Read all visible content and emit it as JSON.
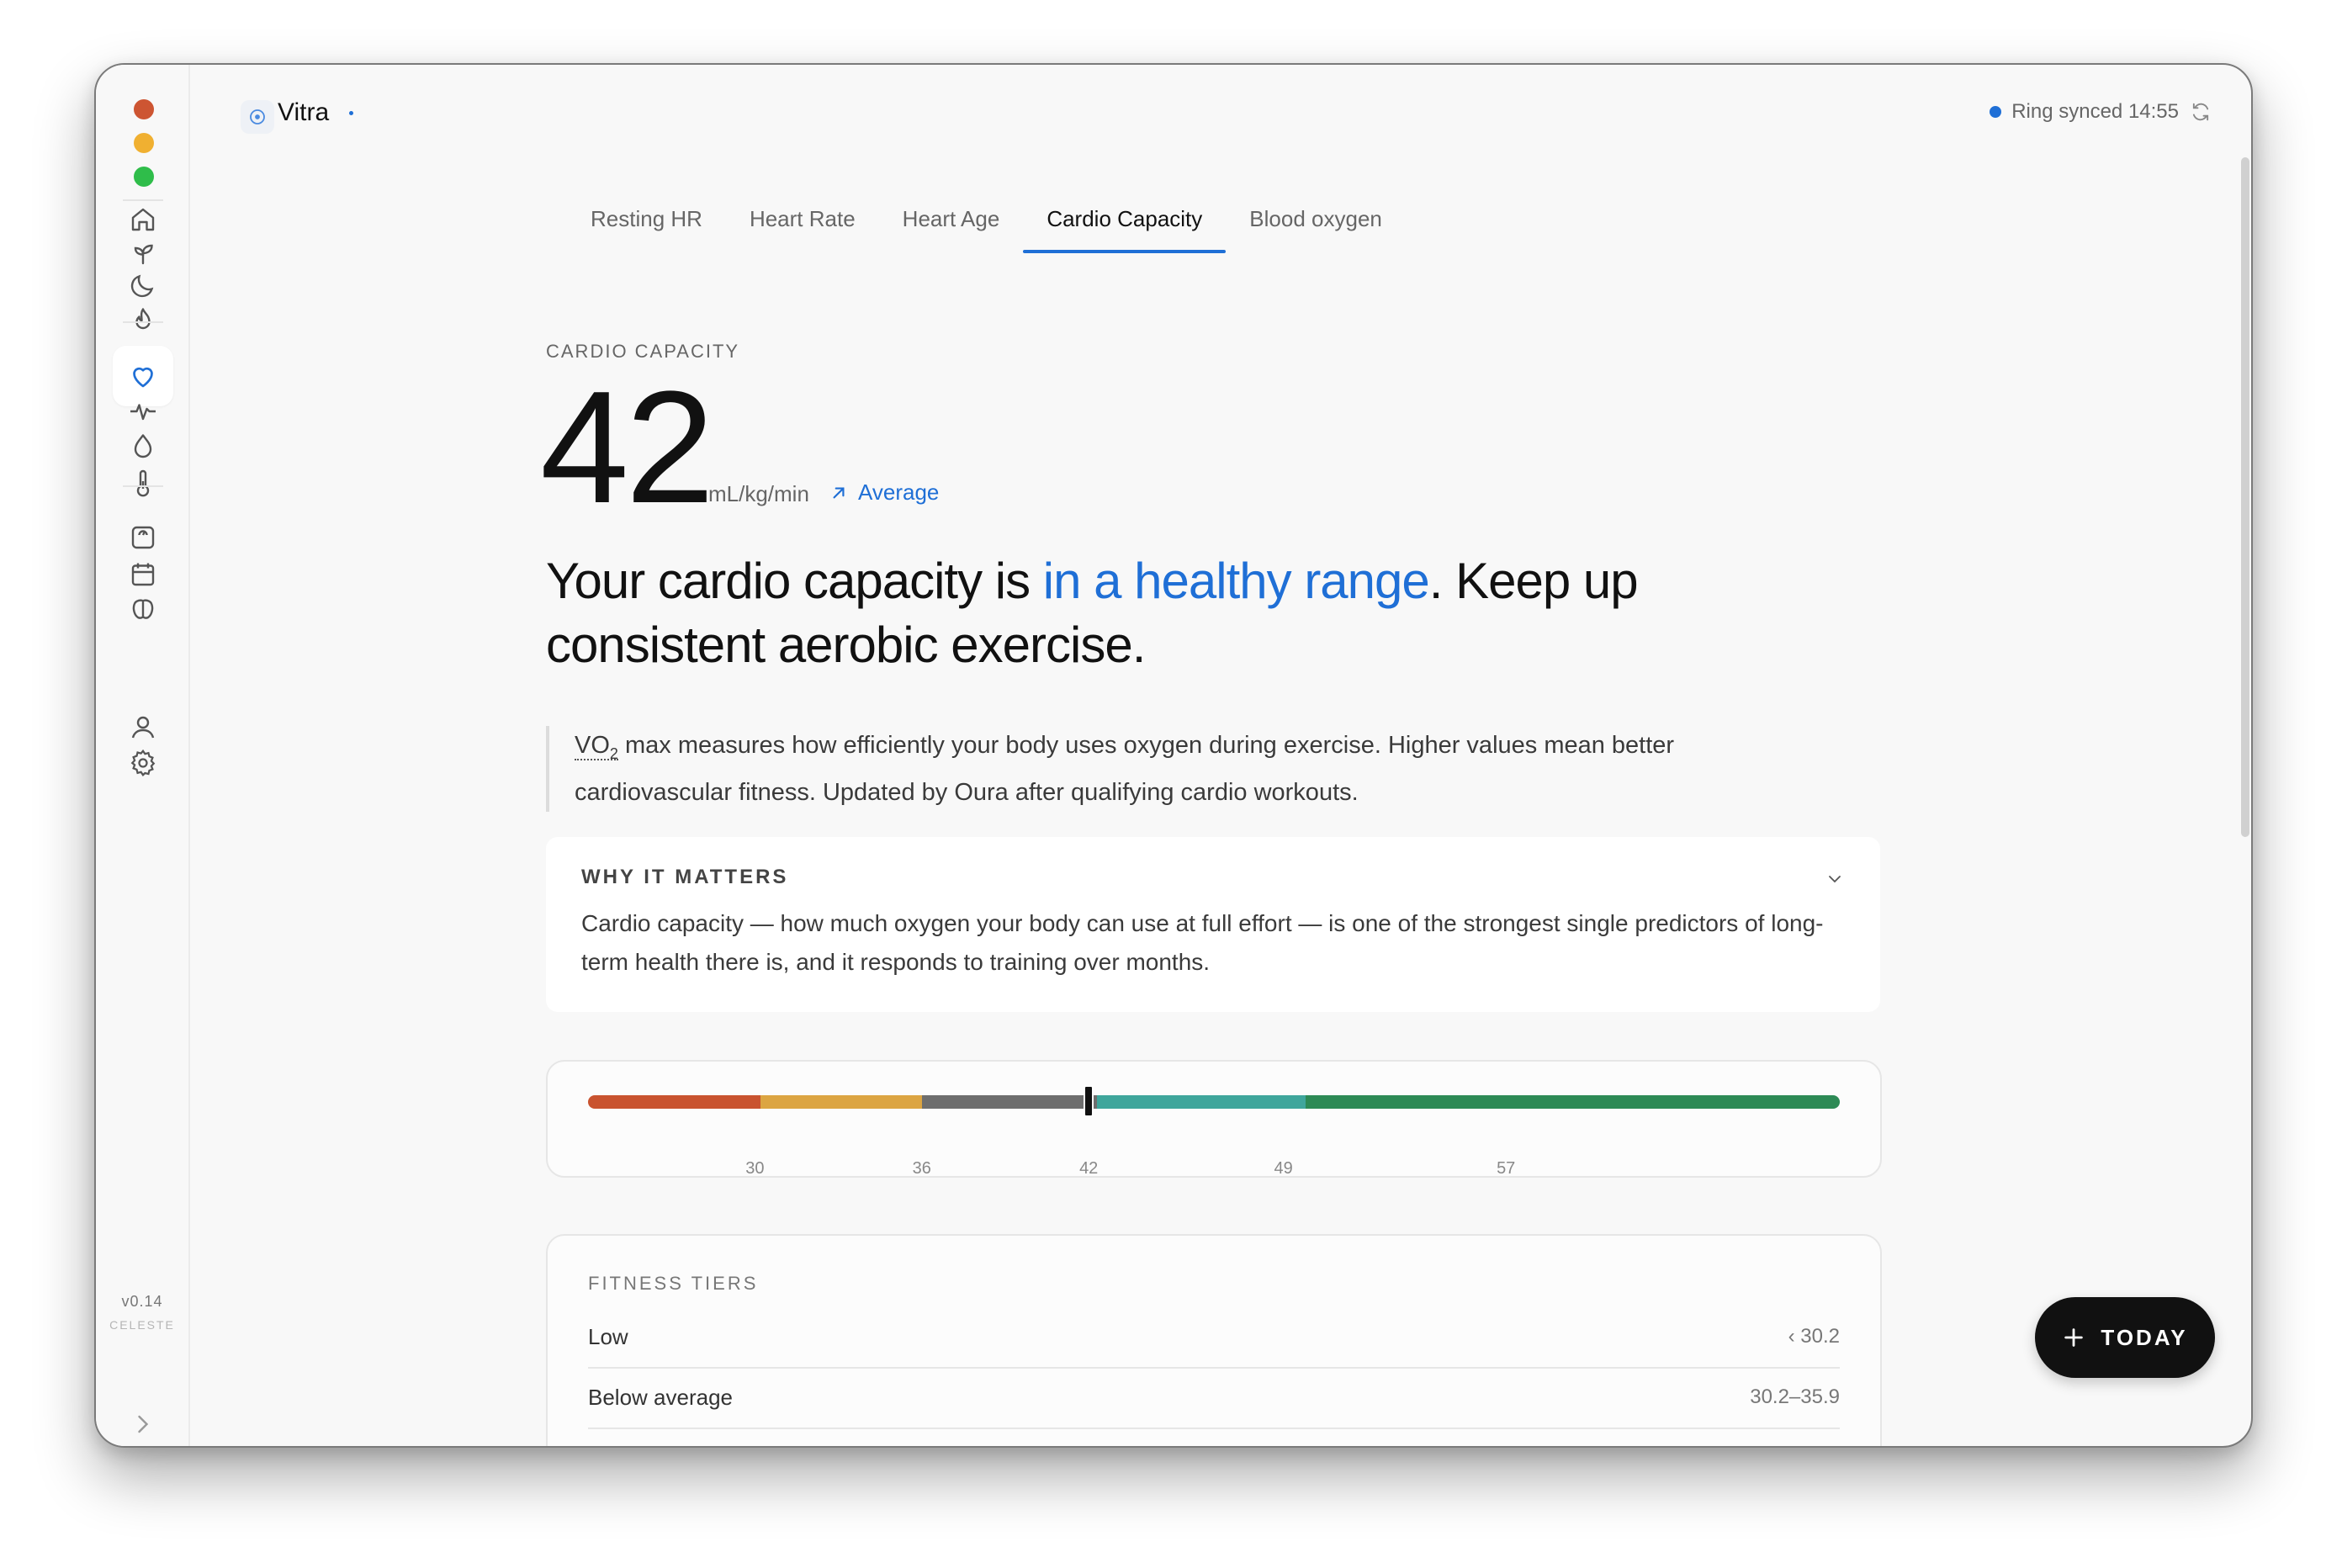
{
  "app": {
    "title": "Vitra",
    "version": "v0.14",
    "edition": "CELESTE"
  },
  "sync": {
    "status": "Ring synced 14:55"
  },
  "sidebar": {
    "items": [
      {
        "name": "home-icon"
      },
      {
        "name": "sprout-icon"
      },
      {
        "name": "moon-icon"
      },
      {
        "name": "flame-icon"
      },
      {
        "name": "heart-icon",
        "active": true
      },
      {
        "name": "heartbeat-icon"
      },
      {
        "name": "drop-icon"
      },
      {
        "name": "thermometer-icon"
      },
      {
        "name": "scale-icon"
      },
      {
        "name": "calendar-icon"
      },
      {
        "name": "brain-icon"
      },
      {
        "name": "user-icon"
      },
      {
        "name": "gear-icon"
      }
    ]
  },
  "tabs": [
    {
      "label": "Resting HR"
    },
    {
      "label": "Heart Rate"
    },
    {
      "label": "Heart Age"
    },
    {
      "label": "Cardio Capacity",
      "active": true
    },
    {
      "label": "Blood oxygen"
    }
  ],
  "metric": {
    "eyebrow": "CARDIO CAPACITY",
    "value": "42",
    "unit": "mL/kg/min",
    "rating": "Average"
  },
  "headline": {
    "before": "Your cardio capacity is ",
    "highlight": "in a healthy range",
    "after": ". Keep up consistent aerobic exercise."
  },
  "description": {
    "abbr": "VO",
    "abbr_sub": "2",
    "text": " max measures how efficiently your body uses oxygen during exercise. Higher values mean better cardiovascular fitness. Updated by Oura after qualifying cardio workouts."
  },
  "why": {
    "title": "WHY IT MATTERS",
    "body": "Cardio capacity — how much oxygen your body can use at full effort — is one of the strongest single predictors of long-term health there is, and it responds to training over months."
  },
  "scale": {
    "min": 24,
    "max": 69,
    "marker": 42,
    "ticks": [
      30,
      36,
      42,
      49,
      57
    ],
    "segments": [
      {
        "from": 24,
        "to": 30.2,
        "color": "#c9532f"
      },
      {
        "from": 30.2,
        "to": 36,
        "color": "#dca542"
      },
      {
        "from": 36,
        "to": 42.3,
        "color": "#6e6e6e"
      },
      {
        "from": 42.3,
        "to": 49.8,
        "color": "#3fa69c"
      },
      {
        "from": 49.8,
        "to": 69,
        "color": "#2d8a55"
      }
    ]
  },
  "tiers": {
    "title": "FITNESS TIERS",
    "rows": [
      {
        "label": "Low",
        "value": "‹ 30.2"
      },
      {
        "label": "Below average",
        "value": "30.2–35.9"
      }
    ]
  },
  "fab": {
    "label": "TODAY"
  },
  "colors": {
    "accent": "#1f6fd6",
    "ink": "#111111"
  }
}
